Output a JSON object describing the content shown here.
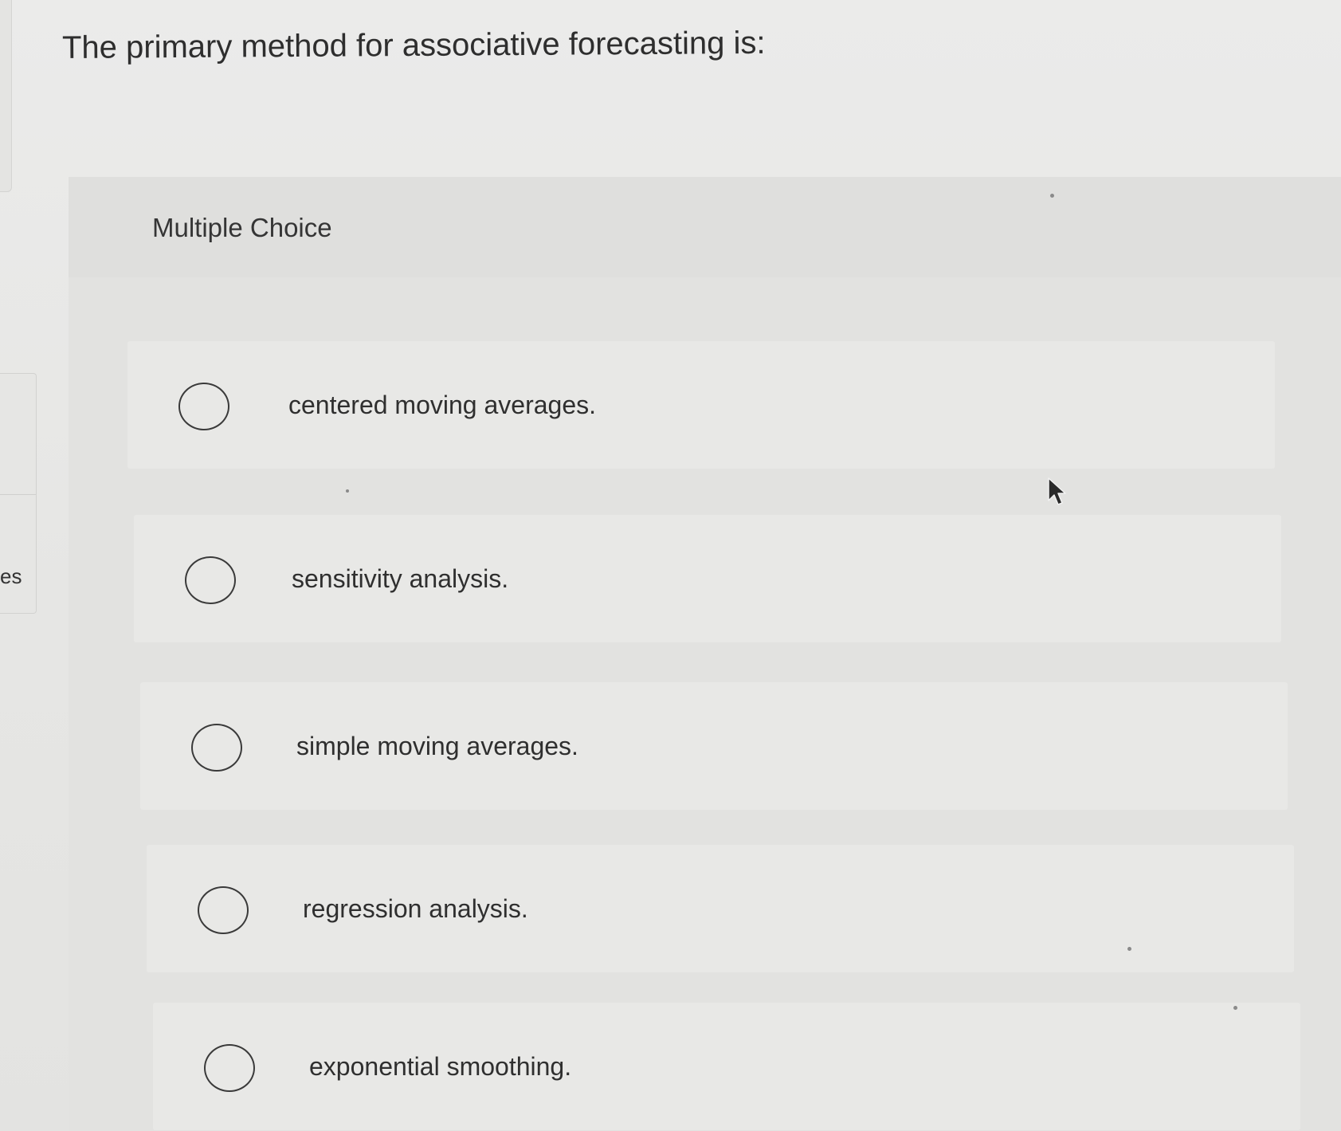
{
  "question": {
    "text": "The primary method for associative forecasting is:"
  },
  "sidebar": {
    "fragment_text": "es"
  },
  "multiple_choice": {
    "label": "Multiple Choice",
    "options": [
      {
        "label": "centered moving averages.",
        "selected": false
      },
      {
        "label": "sensitivity analysis.",
        "selected": false
      },
      {
        "label": "simple moving averages.",
        "selected": false
      },
      {
        "label": "regression analysis.",
        "selected": false
      },
      {
        "label": "exponential smoothing.",
        "selected": false
      }
    ]
  },
  "icons": {
    "cursor": "mouse-pointer-icon",
    "radio": "radio-circle-icon"
  },
  "colors": {
    "background": "#e7e7e5",
    "panel": "#e2e2e0",
    "option_card": "#e8e8e6",
    "text": "#2f2f2f",
    "radio_border": "#3a3a3a"
  }
}
